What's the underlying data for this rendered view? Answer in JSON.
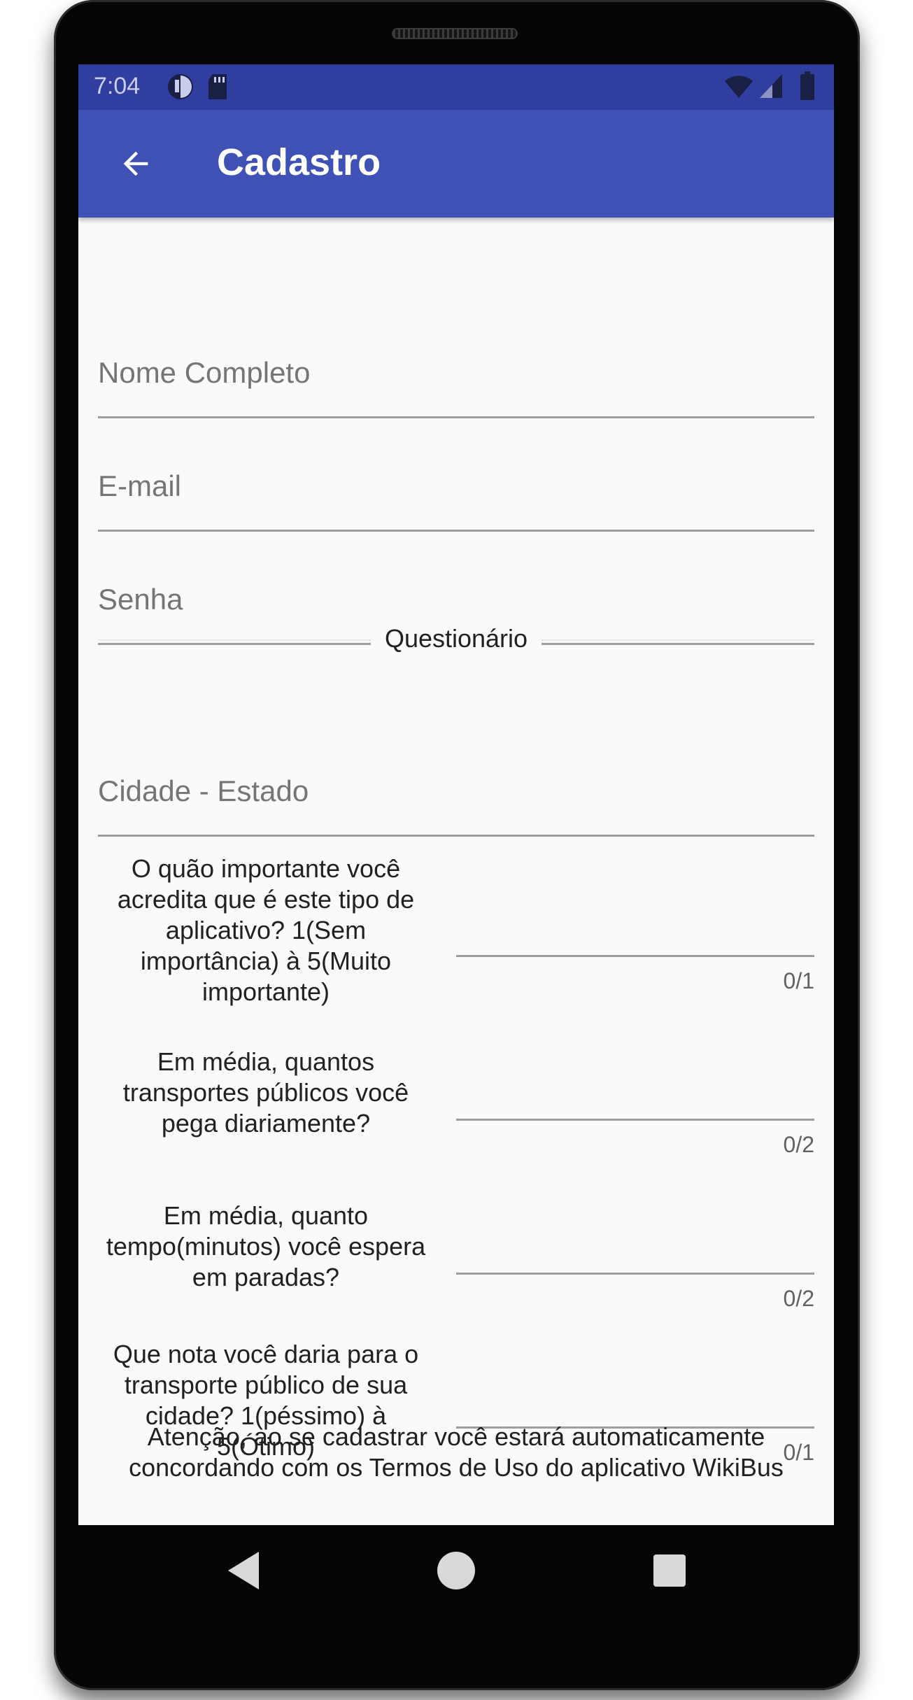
{
  "status_bar": {
    "time": "7:04",
    "icons": [
      "notification-icon",
      "sd-card-icon",
      "wifi-icon",
      "signal-icon",
      "battery-icon"
    ]
  },
  "app_bar": {
    "title": "Cadastro",
    "back_icon": "arrow-back-icon",
    "background": "#3f51b5",
    "status_background": "#303f9f"
  },
  "form": {
    "name_placeholder": "Nome Completo",
    "email_placeholder": "E-mail",
    "password_placeholder": "Senha",
    "section_title": "Questionário",
    "city_placeholder": "Cidade - Estado",
    "questions": [
      {
        "text": "O quão importante você acredita que é este tipo de aplicativo? 1(Sem importância) à 5(Muito importante)",
        "counter": "0/1"
      },
      {
        "text": "Em média, quantos transportes públicos você pega diariamente?",
        "counter": "0/2"
      },
      {
        "text": "Em média, quanto tempo(minutos) você espera em paradas?",
        "counter": "0/2"
      },
      {
        "text": "Que nota você daria para o transporte público de sua cidade? 1(péssimo) à 5(Ótimo)",
        "counter": "0/1"
      }
    ],
    "terms_text": "Atenção, ao se cadastrar você estará automaticamente concordando com os Termos de Uso do aplicativo WikiBus"
  },
  "nav_bar": {
    "back": "nav-back-icon",
    "home": "nav-home-icon",
    "recents": "nav-recents-icon"
  }
}
